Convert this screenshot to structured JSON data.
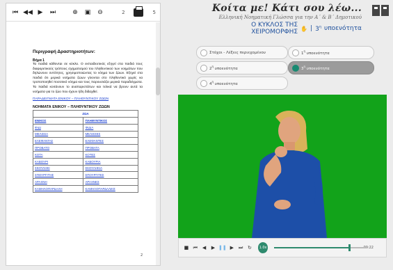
{
  "pdf": {
    "toolbar": {
      "first_icon": "⏮",
      "prev_icon": "◀◀",
      "next_icon": "▶",
      "last_icon": "⏭",
      "zoom_in_icon": "⊕",
      "fit_icon": "▣",
      "zoom_out_icon": "⊖",
      "page_current": "2",
      "page_total": "5"
    },
    "heading": "Περιγραφή Δραστηριοτήτων:",
    "step": "Βήμα 1",
    "body": "Τα παιδιά κάθονται σε κύκλο. Ο εκπαιδευτικός εξηγεί στα παιδιά τους διαφορετικούς τρόπους σχηματισμού του πληθυντικού των νοημάτων που δηλώνουν οντότητες, χρησιμοποιώντας το νόημα των ζώων. Εξηγεί στα παιδιά ότι μερικά νοήματα ζώων γίνονται στο πληθυντικό χωρίς να τροποποιηθεί ποσοτικό νόημα και τους παρουσιάζει μερικά παραδείγματα. Τα παιδιά κοιτάνουν το αναπαριστάτων και τελικά να βρουν αυτά τα νοήματα για το ζώο που έχουν ήδη διδαχθεί.",
    "link": "ΠΑΡΑΔΕΙΓΜΑΤΑ ΕΝΙΚΟΥ – ΠΛΗΘΥΝΤΙΚΟΥ ΖΩΩΝ",
    "table_title": "ΝΟΗΜΑΤΑ ΕΝΙΚΟΥ – ΠΛΗΘΥΝΤΙΚΟΥ ΖΩΩΝ",
    "table_subtitle": "ΖΩΑ",
    "table_headers": [
      "ΕΝΙΚΟΣ",
      "ΠΛΗΘΥΝΤΙΚΟΣ"
    ],
    "table_rows": [
      [
        "ΦΙΔΙ",
        "ΦΙΔΙΑ"
      ],
      [
        "ΜΕΛΙΣΣΑ",
        "ΜΕΛΙΣΣΕΣ"
      ],
      [
        "ΕΛΕΦΑΝΤΑΣ",
        "ΕΛΕΦΑΝΤΕΣ"
      ],
      [
        "ΠΡΟΒΑΤΟ",
        "ΠΡΟΒΑΤΑ"
      ],
      [
        "ΚΟΤΑ",
        "ΚΟΤΕΣ"
      ],
      [
        "ΚΑΒΟΥΡΙ",
        "ΚΑΒΟΥΡΙΑ"
      ],
      [
        "ΣΚΟΥΛΗΚΙ",
        "ΣΚΟΥΛΗΚΙΑ"
      ],
      [
        "ΣΠΟΥΡΓΙΤΗΣ",
        "ΣΠΟΥΡΓΙΤΕΣ"
      ],
      [
        "ΑΡΑΧΝΗ",
        "ΑΡΑΧΝΕΣ"
      ],
      [
        "ΚΑΜΗΛΟΠΑΡΔΑΛΗ",
        "ΚΑΜΗΛΟΠΑΡΔΑΛΕΙΣ"
      ]
    ],
    "page_marker": "2"
  },
  "header": {
    "title": "Κοίτα με! Κάτι σου λέω...",
    "subtitle": "Ελληνική Νοηματική Γλώσσα για την Α΄ & Β΄ Δημοτικού",
    "section": "Ο ΚΥΚΛΟΣ ΤΗΣ ΧΕΙΡΟΜΟΡΦΗΣ",
    "unit": "3",
    "unit_sup": "η",
    "unit_label": "υποενότητα"
  },
  "submenu": {
    "items": [
      {
        "label": "Στόχοι - Λέξεις περιεχομένου",
        "sup": "",
        "suffix": "",
        "active": false
      },
      {
        "label": "1",
        "sup": "η",
        "suffix": "υποενότητα",
        "active": false
      },
      {
        "label": "2",
        "sup": "η",
        "suffix": "υποενότητα",
        "active": false
      },
      {
        "label": "3",
        "sup": "η",
        "suffix": "υποενότητα",
        "active": true
      },
      {
        "label": "4",
        "sup": "η",
        "suffix": "υποενότητα",
        "active": false
      }
    ]
  },
  "player": {
    "speed": "1.0x",
    "time": "00:22",
    "progress": 0.8,
    "background_color": "#12a31a",
    "accent_color": "#2e8a6e"
  },
  "icons": {
    "book": "book-icon",
    "print": "print-icon",
    "hand": "hand-icon"
  }
}
